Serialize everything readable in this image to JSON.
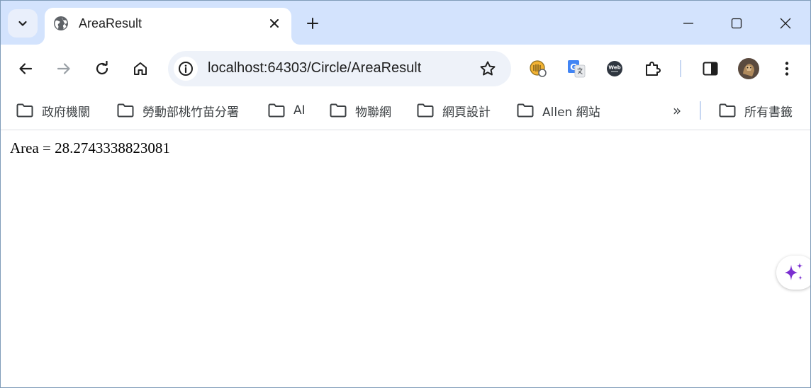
{
  "tab": {
    "title": "AreaResult"
  },
  "toolbar": {
    "url": "localhost:64303/Circle/AreaResult"
  },
  "bookmarks": {
    "items": [
      {
        "label": "政府機關"
      },
      {
        "label": "勞動部桃竹苗分署"
      },
      {
        "label": "AI"
      },
      {
        "label": "物聯網"
      },
      {
        "label": "網頁設計"
      },
      {
        "label": "Allen 網站"
      }
    ],
    "more_symbol": "»",
    "all_bookmarks_label": "所有書籤"
  },
  "page": {
    "result_text": "Area = 28.2743338823081"
  },
  "extensions": {
    "webchatgpt_label": "Web"
  },
  "colors": {
    "tabstrip_bg": "#d3e3fd",
    "omnibox_bg": "#eef2f9",
    "ai_accent": "#7b2fd0"
  }
}
